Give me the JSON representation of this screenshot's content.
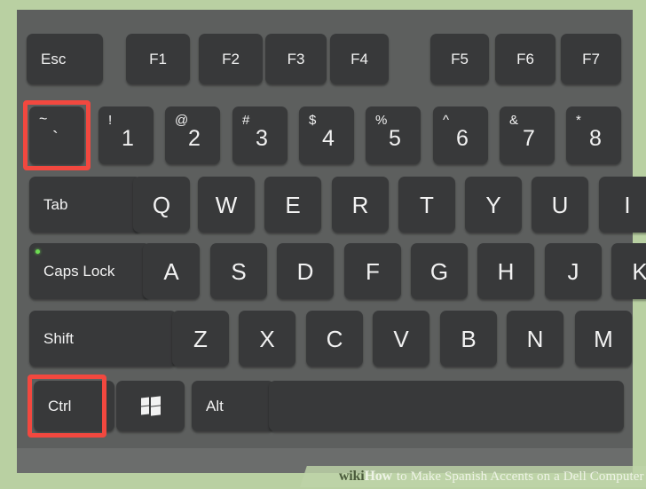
{
  "image": {
    "subject": "dell-laptop-keyboard-closeup",
    "mat_color": "#b9d0a2",
    "chassis_color": "#5d5f5e",
    "key_color": "#38393a",
    "key_text_color": "#f2f2f2",
    "highlight_color": "#f2483f",
    "led_color": "#6ddc52"
  },
  "watermark": {
    "brand_wiki": "wiki",
    "brand_how": "How",
    "title": "to Make Spanish Accents on a Dell Computer",
    "full_text": "wikiHow to Make Spanish Accents on a Dell Computer"
  },
  "keyboard": {
    "rows": [
      {
        "name": "function-row",
        "keys": [
          {
            "name": "esc",
            "label": "Esc",
            "type": "label"
          },
          {
            "name": "f1",
            "label": "F1",
            "type": "fn"
          },
          {
            "name": "f2",
            "label": "F2",
            "type": "fn"
          },
          {
            "name": "f3",
            "label": "F3",
            "type": "fn"
          },
          {
            "name": "f4",
            "label": "F4",
            "type": "fn"
          },
          {
            "name": "f5",
            "label": "F5",
            "type": "fn"
          },
          {
            "name": "f6",
            "label": "F6",
            "type": "fn"
          },
          {
            "name": "f7",
            "label": "F7",
            "type": "fn"
          }
        ]
      },
      {
        "name": "number-row",
        "keys": [
          {
            "name": "backtick-tilde",
            "upper": "~",
            "lower": "`",
            "type": "tilde",
            "highlighted": true
          },
          {
            "name": "digit-1",
            "upper": "!",
            "lower": "1",
            "type": "num"
          },
          {
            "name": "digit-2",
            "upper": "@",
            "lower": "2",
            "type": "num"
          },
          {
            "name": "digit-3",
            "upper": "#",
            "lower": "3",
            "type": "num"
          },
          {
            "name": "digit-4",
            "upper": "$",
            "lower": "4",
            "type": "num"
          },
          {
            "name": "digit-5",
            "upper": "%",
            "lower": "5",
            "type": "num"
          },
          {
            "name": "digit-6",
            "upper": "^",
            "lower": "6",
            "type": "num"
          },
          {
            "name": "digit-7",
            "upper": "&",
            "lower": "7",
            "type": "num"
          },
          {
            "name": "digit-8",
            "upper": "*",
            "lower": "8",
            "type": "num"
          }
        ]
      },
      {
        "name": "qwerty-row",
        "keys": [
          {
            "name": "tab",
            "label": "Tab",
            "type": "label"
          },
          {
            "name": "q",
            "label": "Q",
            "type": "letter"
          },
          {
            "name": "w",
            "label": "W",
            "type": "letter"
          },
          {
            "name": "e",
            "label": "E",
            "type": "letter"
          },
          {
            "name": "r",
            "label": "R",
            "type": "letter"
          },
          {
            "name": "t",
            "label": "T",
            "type": "letter"
          },
          {
            "name": "y",
            "label": "Y",
            "type": "letter"
          },
          {
            "name": "u",
            "label": "U",
            "type": "letter"
          },
          {
            "name": "i",
            "label": "I",
            "type": "letter"
          }
        ]
      },
      {
        "name": "home-row",
        "keys": [
          {
            "name": "caps-lock",
            "label": "Caps Lock",
            "type": "label",
            "led": true
          },
          {
            "name": "a",
            "label": "A",
            "type": "letter"
          },
          {
            "name": "s",
            "label": "S",
            "type": "letter"
          },
          {
            "name": "d",
            "label": "D",
            "type": "letter"
          },
          {
            "name": "f",
            "label": "F",
            "type": "letter"
          },
          {
            "name": "g",
            "label": "G",
            "type": "letter"
          },
          {
            "name": "h",
            "label": "H",
            "type": "letter"
          },
          {
            "name": "j",
            "label": "J",
            "type": "letter"
          },
          {
            "name": "k",
            "label": "K",
            "type": "letter"
          }
        ]
      },
      {
        "name": "shift-row",
        "keys": [
          {
            "name": "shift-left",
            "label": "Shift",
            "type": "label"
          },
          {
            "name": "z",
            "label": "Z",
            "type": "letter"
          },
          {
            "name": "x",
            "label": "X",
            "type": "letter"
          },
          {
            "name": "c",
            "label": "C",
            "type": "letter"
          },
          {
            "name": "v",
            "label": "V",
            "type": "letter"
          },
          {
            "name": "b",
            "label": "B",
            "type": "letter"
          },
          {
            "name": "n",
            "label": "N",
            "type": "letter"
          },
          {
            "name": "m",
            "label": "M",
            "type": "letter"
          }
        ]
      },
      {
        "name": "modifier-row",
        "keys": [
          {
            "name": "ctrl-left",
            "label": "Ctrl",
            "type": "label",
            "highlighted": true
          },
          {
            "name": "windows",
            "label": "",
            "type": "windows-logo"
          },
          {
            "name": "alt-left",
            "label": "Alt",
            "type": "label"
          },
          {
            "name": "spacebar",
            "label": "",
            "type": "blank"
          }
        ]
      }
    ],
    "highlighted_keys": [
      "backtick-tilde",
      "ctrl-left"
    ]
  }
}
